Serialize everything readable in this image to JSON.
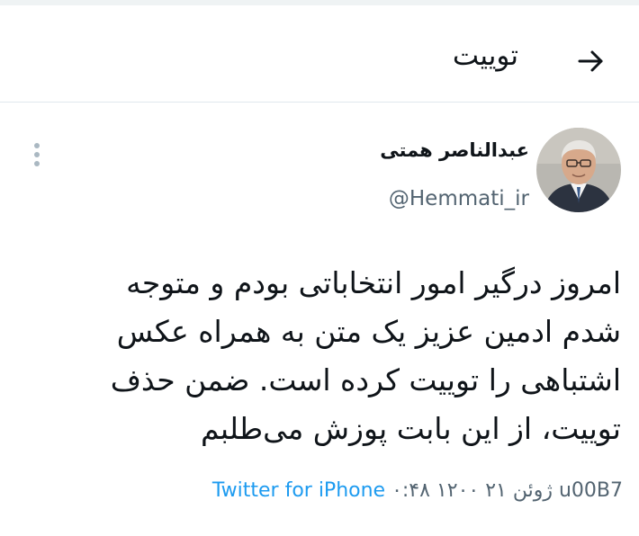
{
  "header": {
    "title": "توییت"
  },
  "tweet": {
    "author_name": "عبدالناصر همتی",
    "author_handle": "@Hemmati_ir",
    "text_lines": [
      "امروز درگیر امور انتخاباتی بودم و متوجه",
      "شدم ادمین عزیز یک متن به همراه عکس",
      "اشتباهی را توییت کرده است. ضمن حذف",
      "توییت، از این بابت پوزش می‌طلبم"
    ],
    "meta": {
      "time_date": "۰:۴۸ ۱۲۰۰ ژوئن ۲۱ u00B7",
      "source": "Twitter for iPhone"
    }
  },
  "colors": {
    "link": "#1d9bf0",
    "secondary_text": "#536471",
    "divider": "#e1e8ed"
  },
  "icons": {
    "back": "arrow-right-icon",
    "more": "more-vertical-icon"
  }
}
